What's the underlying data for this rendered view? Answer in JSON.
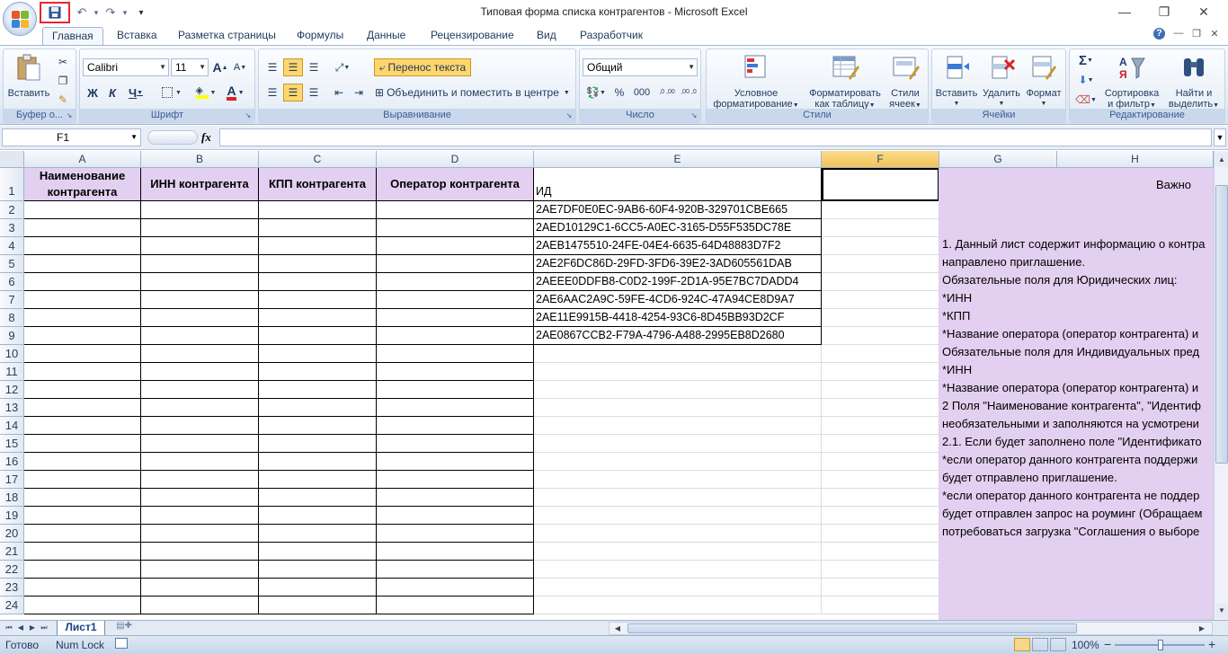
{
  "window": {
    "title": "Типовая форма списка контрагентов - Microsoft Excel",
    "minimize": "—",
    "restore": "❐",
    "close": "✕"
  },
  "qat": {
    "save_icon": "save-icon",
    "undo": "↶",
    "undo_drop": "▾",
    "redo": "↷",
    "redo_drop": "▾",
    "customize": "▾"
  },
  "tabs": [
    "Главная",
    "Вставка",
    "Разметка страницы",
    "Формулы",
    "Данные",
    "Рецензирование",
    "Вид",
    "Разработчик"
  ],
  "tab_icons": {
    "help": "?",
    "minimize": "—",
    "restore": "❐",
    "close": "✕"
  },
  "ribbon": {
    "clipboard": {
      "label": "Буфер о...",
      "paste": "Вставить"
    },
    "font": {
      "label": "Шрифт",
      "name": "Calibri",
      "size": "11",
      "grow": "A",
      "shrink": "A",
      "bold": "Ж",
      "italic": "К",
      "underline": "Ч",
      "font_color": "A"
    },
    "alignment": {
      "label": "Выравнивание",
      "wrap": "Перенос текста",
      "merge": "Объединить и поместить в центре"
    },
    "number": {
      "label": "Число",
      "format": "Общий",
      "percent": "%",
      "thousands": "000",
      "inc_dec": ",0 ,00",
      "dec_dec": ",00 ,0"
    },
    "styles": {
      "label": "Стили",
      "conditional_1": "Условное",
      "conditional_2": "форматирование",
      "table_1": "Форматировать",
      "table_2": "как таблицу",
      "cell_1": "Стили",
      "cell_2": "ячеек"
    },
    "cells": {
      "label": "Ячейки",
      "insert": "Вставить",
      "delete": "Удалить",
      "format": "Формат"
    },
    "editing": {
      "label": "Редактирование",
      "sigma": "Σ",
      "sort_1": "Сортировка",
      "sort_2": "и фильтр",
      "find_1": "Найти и",
      "find_2": "выделить"
    }
  },
  "formula_bar": {
    "name_box": "F1",
    "fx": "fx",
    "value": ""
  },
  "columns": [
    "A",
    "B",
    "C",
    "D",
    "E",
    "F",
    "G",
    "H"
  ],
  "rows": [
    "1",
    "2",
    "3",
    "4",
    "5",
    "6",
    "7",
    "8",
    "9",
    "10",
    "11",
    "12",
    "13",
    "14",
    "15",
    "16",
    "17",
    "18",
    "19",
    "20",
    "21",
    "22",
    "23",
    "24"
  ],
  "headers": {
    "a": "Наименование контрагента",
    "b": "ИНН контрагента",
    "c": "КПП контрагента",
    "d": "Оператор контрагента",
    "e": "ИД"
  },
  "ids": [
    "2AE7DF0E0EC-9AB6-60F4-920B-329701CBE665",
    "2AED10129C1-6CC5-A0EC-3165-D55F535DC78E",
    "2AEB1475510-24FE-04E4-6635-64D48883D7F2",
    "2AE2F6DC86D-29FD-3FD6-39E2-3AD605561DAB",
    "2AEEE0DDFB8-C0D2-199F-2D1A-95E7BC7DADD4",
    "2AE6AAC2A9C-59FE-4CD6-924C-47A94CE8D9A7",
    "2AE11E9915B-4418-4254-93C6-8D45BB93D2CF",
    "2AE0867CCB2-F79A-4796-A488-2995EB8D2680"
  ],
  "note": {
    "title": "Важно",
    "lines": [
      "1. Данный лист содержит информацию о контра",
      "направлено приглашение.",
      "Обязательные поля для Юридических лиц:",
      "*ИНН",
      "*КПП",
      "*Название оператора (оператор контрагента) и",
      "Обязательные поля для Индивидуальных пред",
      "*ИНН",
      "*Название оператора (оператор контрагента) и",
      "2 Поля \"Наименование контрагента\", \"Идентиф",
      "необязательными и заполняются на усмотрени",
      "2.1. Если будет заполнено поле \"Идентификато",
      "*если оператор данного контрагента поддержи",
      "будет отправлено приглашение.",
      "*если оператор данного контрагента не поддер",
      "будет отправлен запрос на роуминг (Обращаем",
      "потребоваться загрузка \"Соглашения о выборе"
    ]
  },
  "sheet": {
    "tab": "Лист1"
  },
  "status": {
    "ready": "Готово",
    "numlock": "Num Lock",
    "zoom": "100%",
    "zoom_out": "−",
    "zoom_in": "+"
  },
  "colors": {
    "header_fill": "#e3cff0",
    "accent": "#15428b"
  }
}
